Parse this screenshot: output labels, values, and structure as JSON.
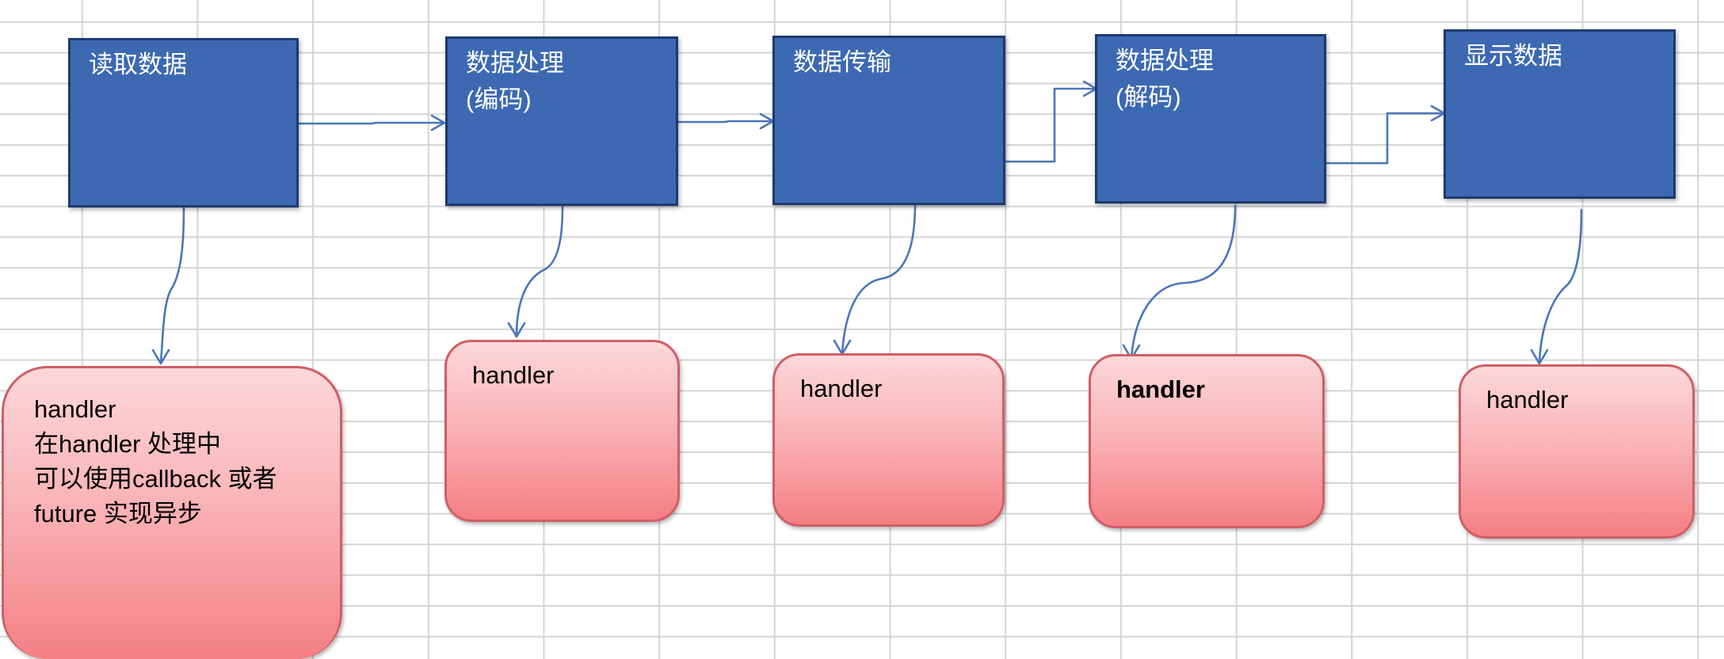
{
  "process_steps": [
    {
      "lines": [
        "读取数据"
      ]
    },
    {
      "lines": [
        "数据处理",
        "(编码)"
      ]
    },
    {
      "lines": [
        "数据传输"
      ]
    },
    {
      "lines": [
        "数据处理",
        "(解码)"
      ]
    },
    {
      "lines": [
        "显示数据"
      ]
    }
  ],
  "handlers": [
    {
      "lines": [
        "handler",
        "在handler 处理中",
        "可以使用callback 或者",
        "future 实现异步"
      ]
    },
    {
      "lines": [
        "handler"
      ]
    },
    {
      "lines": [
        "handler"
      ]
    },
    {
      "lines": [
        "handler"
      ]
    },
    {
      "lines": [
        "handler"
      ]
    }
  ],
  "colors": {
    "process_fill": "#3c69b2",
    "process_border": "#1e3a6f",
    "handler_fill_top": "#fdd8da",
    "handler_fill_bottom": "#f47f84",
    "handler_border": "#cf5f66",
    "connector": "#4a76b8",
    "grid": "#d4d4d4"
  }
}
